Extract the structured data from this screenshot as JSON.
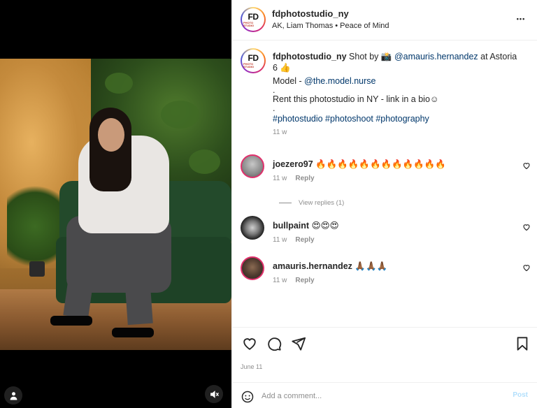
{
  "post": {
    "username": "fdphotostudio_ny",
    "audio_line": "AK, Liam Thomas • Peace of Mind",
    "more": "•••"
  },
  "caption": {
    "username": "fdphotostudio_ny",
    "text_shot_by": "Shot by 📸",
    "mention_photographer": "@amauris.hernandez",
    "text_at": "at Astoria 6 👍",
    "model_label": "Model -",
    "mention_model": "@the.model.nurse",
    "dot1": ".",
    "rent_line": "Rent this photostudio in NY - link in a bio☺",
    "dot2": ".",
    "hashtags": "#photostudio #photoshoot #photography",
    "time": "11 w"
  },
  "comments": [
    {
      "username": "joezero97",
      "text": "🔥🔥🔥🔥🔥🔥🔥🔥🔥🔥🔥🔥",
      "time": "11 w",
      "reply": "Reply"
    },
    {
      "username": "bullpaint",
      "text": "😍😍😍",
      "time": "11 w",
      "reply": "Reply"
    },
    {
      "username": "amauris.hernandez",
      "text": "🙏🏾🙏🏾🙏🏾",
      "time": "11 w",
      "reply": "Reply"
    }
  ],
  "view_replies": "View replies (1)",
  "date": "June 11",
  "add_comment": {
    "placeholder": "Add a comment...",
    "post_label": "Post"
  },
  "logo": {
    "main": "FD",
    "sub": "PHOTO STUDIO"
  },
  "colors": {
    "link": "#00376b",
    "muted": "#8e8e8e",
    "post_button": "#b2dffc"
  },
  "icons": [
    "user-tag-icon",
    "speaker-muted-icon",
    "more-icon",
    "heart-icon",
    "comment-icon",
    "share-icon",
    "bookmark-icon",
    "emoji-icon"
  ]
}
